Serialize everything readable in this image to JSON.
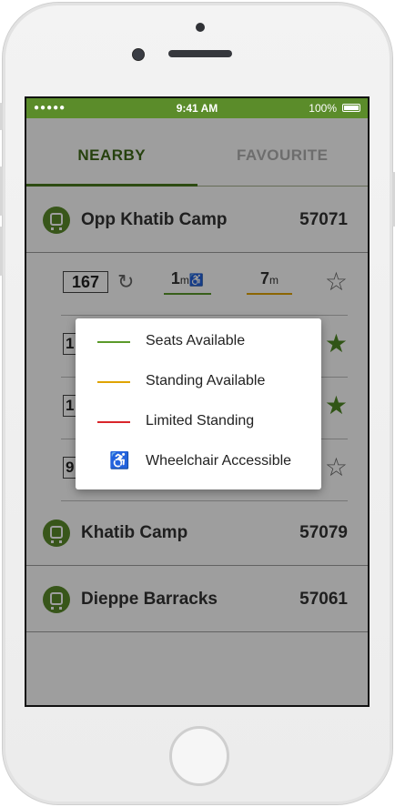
{
  "status_bar": {
    "signal": "●●●●●",
    "time": "9:41 AM",
    "battery": "100%"
  },
  "tabs": [
    {
      "label": "NEARBY"
    },
    {
      "label": "FAVOURITE"
    }
  ],
  "stops": [
    {
      "name": "Opp Khatib Camp",
      "code": "57071"
    },
    {
      "name": "Khatib Camp",
      "code": "57079"
    },
    {
      "name": "Dieppe Barracks",
      "code": "57061"
    }
  ],
  "buses": [
    {
      "service": "167",
      "eta1": "1",
      "eta1_unit": "m",
      "eta2": "7",
      "eta2_unit": "m",
      "wheelchair": "♿",
      "starred": false
    },
    {
      "service": "1",
      "starred": true
    },
    {
      "service": "1",
      "starred": true
    },
    {
      "service": "9",
      "starred": false
    }
  ],
  "legend": {
    "colors": {
      "seats": "#5b9a2a",
      "standing": "#e0a400",
      "limited": "#d9262b"
    },
    "items": [
      {
        "label": "Seats Available"
      },
      {
        "label": "Standing Available"
      },
      {
        "label": "Limited Standing"
      },
      {
        "label": "Wheelchair Accessible",
        "icon": "♿"
      }
    ]
  },
  "icons": {
    "refresh": "↻",
    "star_empty": "☆",
    "star_filled": "★"
  }
}
